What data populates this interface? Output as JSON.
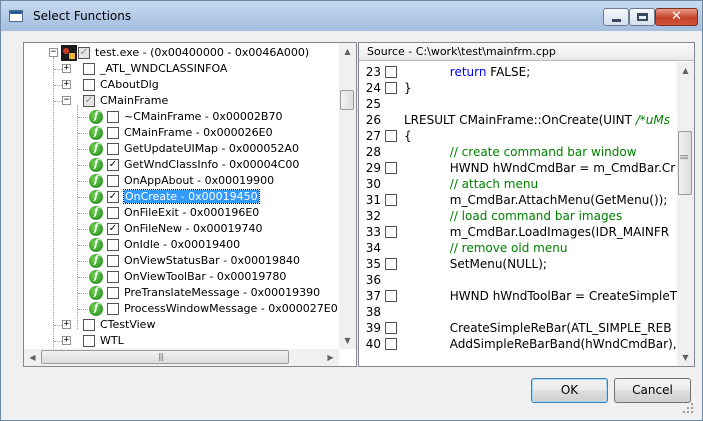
{
  "window": {
    "title": "Select Functions"
  },
  "tree": {
    "root_label": "test.exe - (0x00400000 - 0x0046A000)",
    "nodes": [
      {
        "label": "_ATL_WNDCLASSINFOA",
        "level": 1,
        "expander": "+",
        "checked": false,
        "icon": "none"
      },
      {
        "label": "CAboutDlg",
        "level": 1,
        "expander": "+",
        "checked": false,
        "icon": "none"
      },
      {
        "label": "CMainFrame",
        "level": 1,
        "expander": "-",
        "checked": "partial",
        "icon": "none"
      },
      {
        "label": "~CMainFrame - 0x00002B70",
        "level": 2,
        "checked": false,
        "icon": "function"
      },
      {
        "label": "CMainFrame - 0x000026E0",
        "level": 2,
        "checked": false,
        "icon": "function"
      },
      {
        "label": "GetUpdateUIMap - 0x000052A0",
        "level": 2,
        "checked": false,
        "icon": "function"
      },
      {
        "label": "GetWndClassInfo - 0x00004C00",
        "level": 2,
        "checked": true,
        "icon": "function"
      },
      {
        "label": "OnAppAbout - 0x00019900",
        "level": 2,
        "checked": false,
        "icon": "function"
      },
      {
        "label": "OnCreate - 0x00019450",
        "level": 2,
        "checked": true,
        "icon": "function",
        "selected": true
      },
      {
        "label": "OnFileExit - 0x000196E0",
        "level": 2,
        "checked": false,
        "icon": "function"
      },
      {
        "label": "OnFileNew - 0x00019740",
        "level": 2,
        "checked": true,
        "icon": "function"
      },
      {
        "label": "OnIdle - 0x00019400",
        "level": 2,
        "checked": false,
        "icon": "function"
      },
      {
        "label": "OnViewStatusBar - 0x00019840",
        "level": 2,
        "checked": false,
        "icon": "function"
      },
      {
        "label": "OnViewToolBar - 0x00019780",
        "level": 2,
        "checked": false,
        "icon": "function"
      },
      {
        "label": "PreTranslateMessage - 0x00019390",
        "level": 2,
        "checked": false,
        "icon": "function"
      },
      {
        "label": "ProcessWindowMessage - 0x000027E0",
        "level": 2,
        "checked": false,
        "icon": "function"
      },
      {
        "label": "CTestView",
        "level": 1,
        "expander": "+",
        "checked": false,
        "icon": "none"
      },
      {
        "label": "WTL",
        "level": 1,
        "expander": "+",
        "checked": false,
        "icon": "none"
      }
    ],
    "vscroll_position": 0.12,
    "hscroll_position": 0.0
  },
  "source": {
    "header": "Source - C:\\work\\test\\mainfrm.cpp",
    "lines": [
      {
        "num": "23",
        "checkbox": true,
        "text": "            ",
        "keyword": "return",
        "rest": " FALSE;",
        "type": "code"
      },
      {
        "num": "24",
        "checkbox": true,
        "text": "}",
        "type": "code"
      },
      {
        "num": "25",
        "checkbox": false,
        "text": "",
        "type": "code"
      },
      {
        "num": "26",
        "checkbox": false,
        "text": "LRESULT CMainFrame::OnCreate(UINT ",
        "comment_tail": "/*uMs",
        "type": "code"
      },
      {
        "num": "27",
        "checkbox": true,
        "text": "{",
        "type": "code"
      },
      {
        "num": "28",
        "checkbox": false,
        "text": "            // create command bar window",
        "type": "comment"
      },
      {
        "num": "29",
        "checkbox": true,
        "text": "            HWND hWndCmdBar = m_CmdBar.Cr",
        "type": "code"
      },
      {
        "num": "30",
        "checkbox": false,
        "text": "            // attach menu",
        "type": "comment"
      },
      {
        "num": "31",
        "checkbox": true,
        "text": "            m_CmdBar.AttachMenu(GetMenu());",
        "type": "code"
      },
      {
        "num": "32",
        "checkbox": false,
        "text": "            // load command bar images",
        "type": "comment"
      },
      {
        "num": "33",
        "checkbox": true,
        "text": "            m_CmdBar.LoadImages(IDR_MAINFR",
        "type": "code"
      },
      {
        "num": "34",
        "checkbox": false,
        "text": "            // remove old menu",
        "type": "comment"
      },
      {
        "num": "35",
        "checkbox": true,
        "text": "            SetMenu(NULL);",
        "type": "code"
      },
      {
        "num": "36",
        "checkbox": false,
        "text": "",
        "type": "code"
      },
      {
        "num": "37",
        "checkbox": true,
        "text": "            HWND hWndToolBar = CreateSimpleT",
        "type": "code"
      },
      {
        "num": "38",
        "checkbox": false,
        "text": "",
        "type": "code"
      },
      {
        "num": "39",
        "checkbox": true,
        "text": "            CreateSimpleReBar(ATL_SIMPLE_REB",
        "type": "code"
      },
      {
        "num": "40",
        "checkbox": true,
        "text": "            AddSimpleReBarBand(hWndCmdBar),",
        "type": "code"
      }
    ],
    "vscroll_position": 0.25
  },
  "buttons": {
    "ok": "OK",
    "cancel": "Cancel"
  }
}
